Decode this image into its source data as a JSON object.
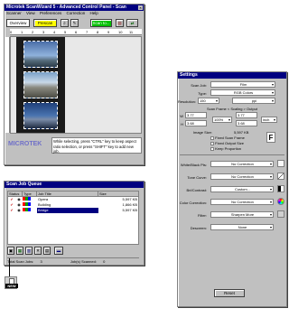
{
  "main_window": {
    "title": "Microtek ScanWizard 5 - Advanced Control Panel - Scan",
    "menus": [
      "Scanner",
      "View",
      "Preferences",
      "Correction",
      "Help"
    ],
    "overview_label": "Overview",
    "prescan_label": "Prescan",
    "scan_label": "Scan to...",
    "ruler_numbers": [
      "0",
      "1",
      "2",
      "3",
      "4",
      "5",
      "6",
      "7",
      "8",
      "9",
      "10",
      "11",
      "12"
    ],
    "brand": "MICROTEK",
    "hint_text": "While selecting, press \"CTRL\" key to keep aspect ratio selection, or press \"SHIFT\" key to add new job."
  },
  "settings": {
    "title": "Settings",
    "scan_job_label": "Scan Job:",
    "scan_job_value": "Film",
    "type_label": "Type:",
    "type_value": "RGB Colors",
    "resolution_label": "Resolution:",
    "resolution_value": "150",
    "resolution_unit": "ppi",
    "frame_header": "Scan Frame  <  Scaling  >  Output",
    "w_label": "W",
    "w_value": "3.77",
    "w_out": "3.77",
    "scale_value": "100%",
    "unit_value": "inch",
    "h_label": "H",
    "h_value": "3.68",
    "h_out": "3.68",
    "image_size_label": "Image Size:",
    "image_size_value": "5,597 KB",
    "fixed_scan_frame": "Fixed Scan Frame",
    "fixed_output_size": "Fixed Output Size",
    "keep_proportion": "Keep Proportion",
    "white_black_label": "White/Black Pts:",
    "white_black_value": "No Correction",
    "tone_curve_label": "Tone Curve:",
    "tone_curve_value": "No Correction",
    "brt_contrast_label": "Brt/Contrast:",
    "brt_contrast_value": "Custom...",
    "color_corr_label": "Color Correction:",
    "color_corr_value": "No Correction",
    "filter_label": "Filter:",
    "filter_value": "Sharpen More",
    "descreen_label": "Descreen:",
    "descreen_value": "None",
    "reset_label": "Reset"
  },
  "queue": {
    "title": "Scan Job Queue",
    "columns": [
      "Status",
      "Type",
      "Job Title",
      "Size"
    ],
    "rows": [
      {
        "title": "Opera",
        "size": "5,597 KB"
      },
      {
        "title": "Building",
        "size": "1,866 KB"
      },
      {
        "title": "Bridge",
        "size": "5,597 KB"
      }
    ],
    "total_label": "Total Scan Jobs:",
    "total_value": "3",
    "scanned_label": "Job(s) Scanned:",
    "scanned_value": "0"
  },
  "new_icon_label": "NEW"
}
